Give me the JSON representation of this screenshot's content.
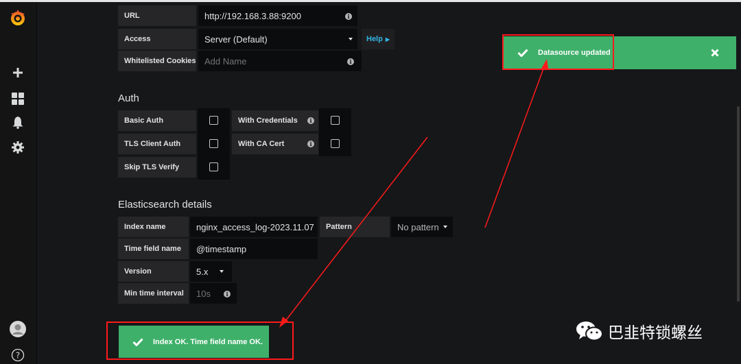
{
  "sidebar": {
    "items": [
      {
        "icon": "grafana-logo-icon"
      },
      {
        "icon": "plus-icon"
      },
      {
        "icon": "dashboards-icon"
      },
      {
        "icon": "bell-icon"
      },
      {
        "icon": "gear-icon"
      },
      {
        "icon": "avatar-icon"
      },
      {
        "icon": "help-circle-icon",
        "label": "?"
      }
    ]
  },
  "http": {
    "url_label": "URL",
    "url_value": "http://192.168.3.88:9200",
    "access_label": "Access",
    "access_value": "Server (Default)",
    "help_label": "Help",
    "cookies_label": "Whitelisted Cookies",
    "cookies_placeholder": "Add Name"
  },
  "auth": {
    "title": "Auth",
    "basic_auth": "Basic Auth",
    "with_credentials": "With Credentials",
    "tls_client_auth": "TLS Client Auth",
    "with_ca_cert": "With CA Cert",
    "skip_tls_verify": "Skip TLS Verify",
    "checked": {
      "basic_auth": false,
      "with_credentials": false,
      "tls_client_auth": false,
      "with_ca_cert": false,
      "skip_tls_verify": false
    }
  },
  "elasticsearch": {
    "title": "Elasticsearch details",
    "index_name_label": "Index name",
    "index_name_value": "nginx_access_log-2023.11.07",
    "pattern_label": "Pattern",
    "pattern_value": "No pattern",
    "time_field_label": "Time field name",
    "time_field_value": "@timestamp",
    "version_label": "Version",
    "version_value": "5.x",
    "min_interval_label": "Min time interval",
    "min_interval_placeholder": "10s"
  },
  "toasts": {
    "updated": "Datasource updated",
    "index_ok": "Index OK. Time field name OK."
  },
  "watermark": {
    "text": "巴韭特锁螺丝"
  },
  "colors": {
    "success": "#3fb06a",
    "annotation": "#ff1a1a",
    "link": "#33b5e5"
  }
}
